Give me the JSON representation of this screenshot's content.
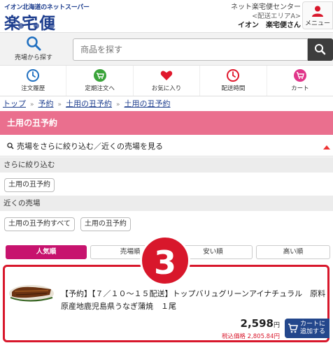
{
  "header": {
    "logo_tagline": "イオン北海道のネットスーパー",
    "logo_text": "楽宅便",
    "center_name": "ネット楽宅便センター",
    "area_label": "<配送エリアA>",
    "user_label": "イオン　楽宅便さん",
    "menu_label": "メニュー"
  },
  "search": {
    "area_button_label": "売場から探す",
    "placeholder": "商品を探す"
  },
  "nav": [
    {
      "label": "注文履歴",
      "icon": "clock-icon"
    },
    {
      "label": "定期注文へ",
      "icon": "cart-repeat-icon"
    },
    {
      "label": "お気に入り",
      "icon": "heart-icon"
    },
    {
      "label": "配送時間",
      "icon": "clock-icon"
    },
    {
      "label": "カート",
      "icon": "cart-icon"
    }
  ],
  "breadcrumb": [
    "トップ",
    "予約",
    "土用の丑予約",
    "土用の丑予約"
  ],
  "page_title": "土用の丑予約",
  "narrow": {
    "heading": "売場をさらに絞り込む／近くの売場を見る",
    "refine_label": "さらに絞り込む",
    "refine_tags": [
      "土用の丑予約"
    ],
    "nearby_label": "近くの売場",
    "nearby_tags": [
      "土用の丑予約すべて",
      "土用の丑予約"
    ]
  },
  "sort_tabs": [
    "人気順",
    "売場順",
    "安い順",
    "高い順"
  ],
  "callout_number": "3",
  "product": {
    "name": "【予約】【７／１０～１５配送】トップバリュグリーンアイナチュラル　原料原産地鹿児島県うなぎ蒲焼　１尾",
    "price": "2,598",
    "price_unit": "円",
    "tax_price": "税込価格 2,805.84円",
    "cart_label_1": "カートに",
    "cart_label_2": "追加する"
  },
  "colors": {
    "brand_blue": "#1f3f8f",
    "title_pink": "#ea6f8e",
    "active_tab": "#c7136e",
    "highlight_red": "#d8172b",
    "cart_button": "#23478c"
  }
}
